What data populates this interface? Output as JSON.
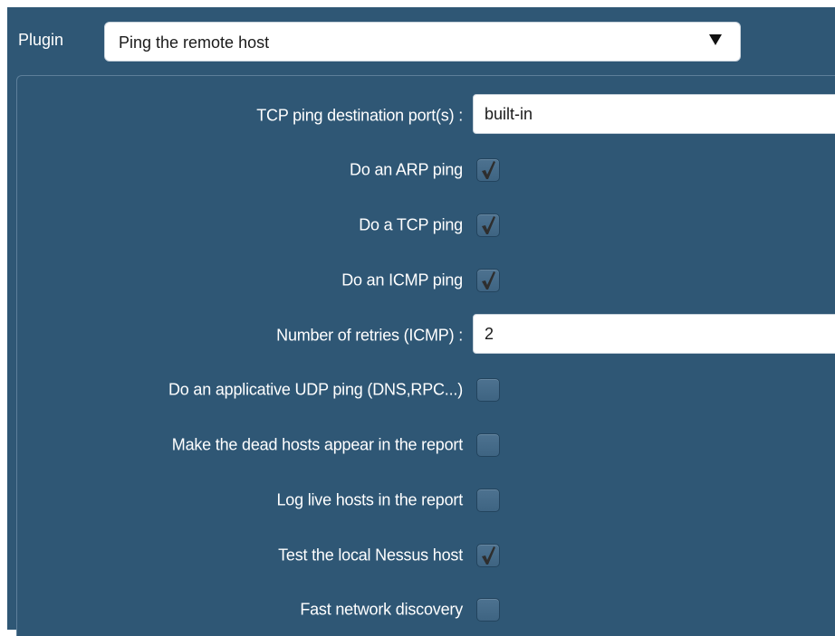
{
  "plugin": {
    "label": "Plugin",
    "selected": "Ping the remote host"
  },
  "settings": [
    {
      "label": "TCP ping destination port(s) :",
      "type": "text",
      "value": "built-in"
    },
    {
      "label": "Do an ARP ping",
      "type": "checkbox",
      "checked": true
    },
    {
      "label": "Do a TCP ping",
      "type": "checkbox",
      "checked": true
    },
    {
      "label": "Do an ICMP ping",
      "type": "checkbox",
      "checked": true
    },
    {
      "label": "Number of retries (ICMP) :",
      "type": "text",
      "value": "2"
    },
    {
      "label": "Do an applicative UDP ping (DNS,RPC...)",
      "type": "checkbox",
      "checked": false
    },
    {
      "label": "Make the dead hosts appear in the report",
      "type": "checkbox",
      "checked": false
    },
    {
      "label": "Log live hosts in the report",
      "type": "checkbox",
      "checked": false
    },
    {
      "label": "Test the local Nessus host",
      "type": "checkbox",
      "checked": true
    },
    {
      "label": "Fast network discovery",
      "type": "checkbox",
      "checked": false
    }
  ],
  "colors": {
    "background": "#2f5775",
    "checkmark": "#2e2e2e"
  }
}
